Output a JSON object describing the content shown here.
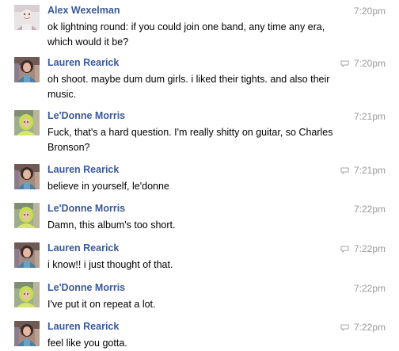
{
  "messages": [
    {
      "author": "Alex Wexelman",
      "time": "7:20pm",
      "text": "ok lightning round: if you could join one band, any time any era, which would it be?",
      "avatar": "avatar-alex",
      "has_reply_icon": false
    },
    {
      "author": "Lauren Rearick",
      "time": "7:20pm",
      "text": "oh shoot. maybe dum dum girls. i liked their tights. and also their music.",
      "avatar": "avatar-lauren",
      "has_reply_icon": true
    },
    {
      "author": "Le'Donne Morris",
      "time": "7:21pm",
      "text": "Fuck, that's a hard question. I'm really shitty on guitar, so Charles Bronson?",
      "avatar": "avatar-ledonne",
      "has_reply_icon": false
    },
    {
      "author": "Lauren Rearick",
      "time": "7:21pm",
      "text": "believe in yourself, le'donne",
      "avatar": "avatar-lauren",
      "has_reply_icon": true
    },
    {
      "author": "Le'Donne Morris",
      "time": "7:22pm",
      "text": "Damn, this album's too short.",
      "avatar": "avatar-ledonne",
      "has_reply_icon": false
    },
    {
      "author": "Lauren Rearick",
      "time": "7:22pm",
      "text": "i know!! i just thought of that.",
      "avatar": "avatar-lauren",
      "has_reply_icon": true
    },
    {
      "author": "Le'Donne Morris",
      "time": "7:22pm",
      "text": "I've put it on repeat a lot.",
      "avatar": "avatar-ledonne",
      "has_reply_icon": false
    },
    {
      "author": "Lauren Rearick",
      "time": "7:22pm",
      "text": "feel like you gotta.",
      "avatar": "avatar-lauren",
      "has_reply_icon": true
    }
  ],
  "colors": {
    "author_link": "#3b5998",
    "timestamp": "#999999",
    "message_text": "#000000"
  }
}
